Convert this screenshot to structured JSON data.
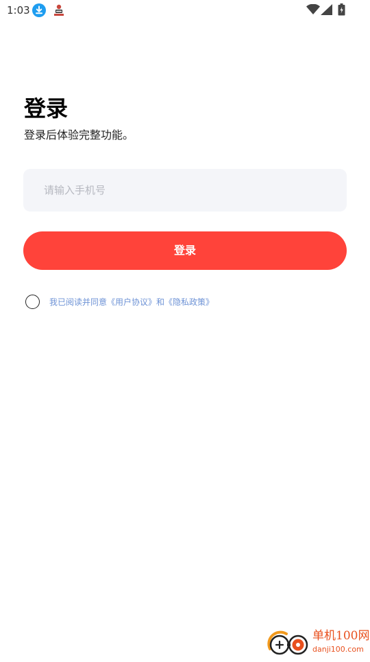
{
  "status_bar": {
    "time": "1:03",
    "icons": [
      "download-icon",
      "app-notification-icon",
      "wifi-icon",
      "signal-icon",
      "battery-icon"
    ]
  },
  "header": {
    "title": "登录",
    "subtitle": "登录后体验完整功能。"
  },
  "form": {
    "phone_placeholder": "请输入手机号",
    "phone_value": "",
    "login_label": "登录"
  },
  "agreement": {
    "checked": false,
    "prefix": "我已阅读并同意",
    "user_agreement": "《用户协议》",
    "conjunction": "和",
    "privacy_policy": "《隐私政策》"
  },
  "watermark": {
    "title": "单机100网",
    "url": "danji100.com"
  },
  "colors": {
    "accent": "#ff433a",
    "input_background": "#f4f5f9",
    "link": "#6e93d6",
    "placeholder": "#b6b8c0",
    "watermark": "#e8501e"
  }
}
